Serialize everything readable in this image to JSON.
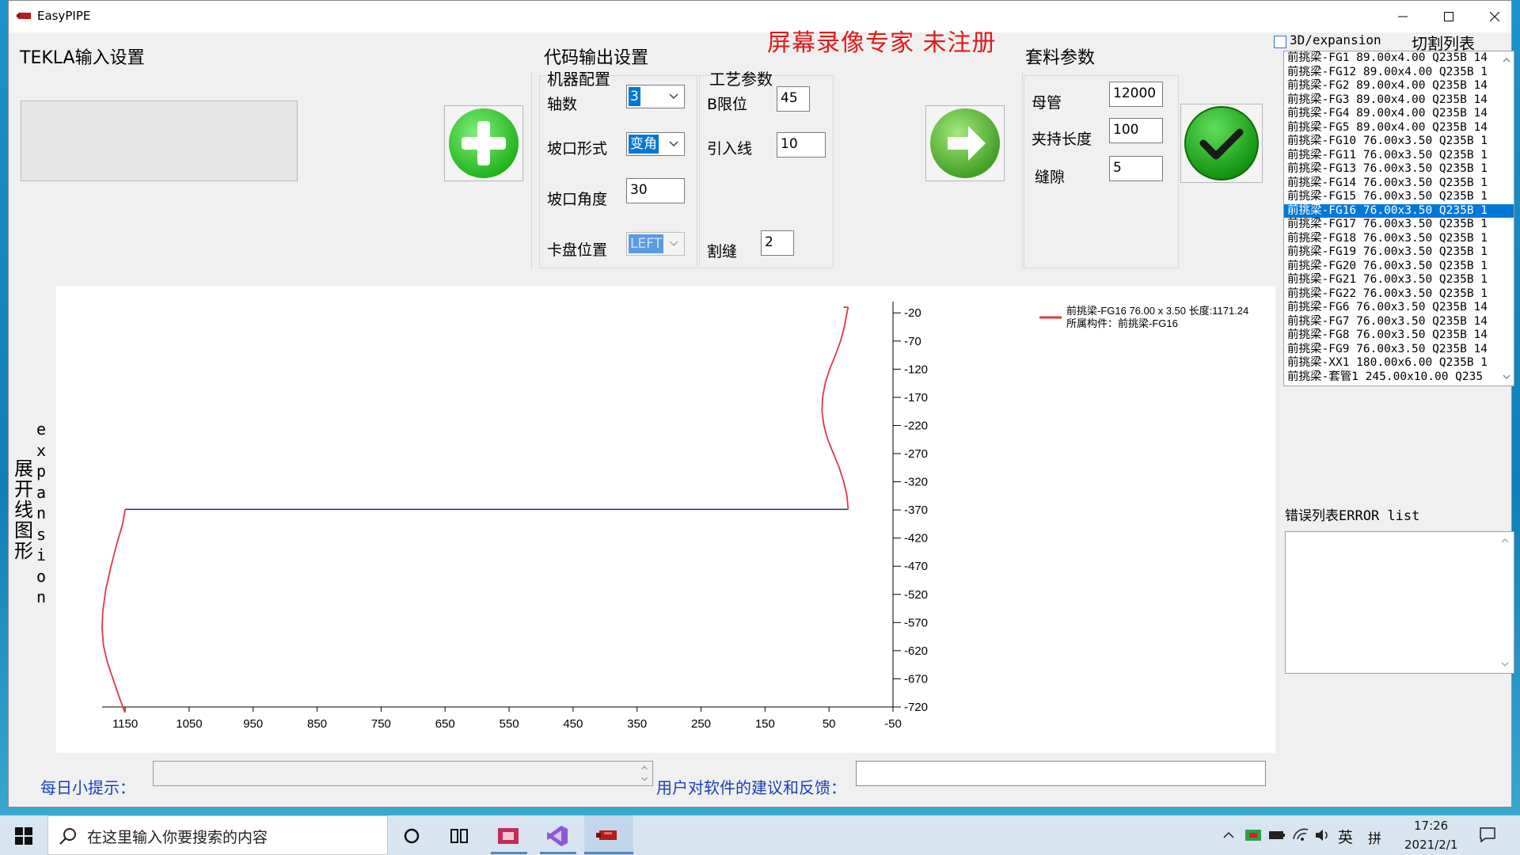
{
  "window": {
    "title": "EasyPIPE"
  },
  "watermark": "屏幕录像专家  未注册",
  "tekla": {
    "title": "TEKLA输入设置"
  },
  "code_output": {
    "title": "代码输出设置",
    "machine": {
      "title": "机器配置",
      "axis_label": "轴数",
      "axis_value": "3",
      "groove_type_label": "坡口形式",
      "groove_type_value": "变角",
      "groove_angle_label": "坡口角度",
      "groove_angle_value": "30",
      "chuck_label": "卡盘位置",
      "chuck_value": "LEFT"
    },
    "process": {
      "title": "工艺参数",
      "b_limit_label": "B限位",
      "b_limit_value": "45",
      "lead_in_label": "引入线",
      "lead_in_value": "10",
      "kerf_label": "割缝",
      "kerf_value": "2"
    }
  },
  "nesting": {
    "title": "套料参数",
    "mother_pipe_label": "母管",
    "mother_pipe_value": "12000",
    "clamp_label": "夹持长度",
    "clamp_value": "100",
    "gap_label": "缝隙",
    "gap_value": "5"
  },
  "right_panel": {
    "checkbox_label": "3D/expansion",
    "cut_list_title": "切割列表",
    "selected_index": 11,
    "items": [
      "前挑梁-FG1 89.00x4.00 Q235B 14",
      "前挑梁-FG12 89.00x4.00 Q235B 1",
      "前挑梁-FG2 89.00x4.00 Q235B 14",
      "前挑梁-FG3 89.00x4.00 Q235B 14",
      "前挑梁-FG4 89.00x4.00 Q235B 14",
      "前挑梁-FG5 89.00x4.00 Q235B 14",
      "前挑梁-FG10 76.00x3.50 Q235B 1",
      "前挑梁-FG11 76.00x3.50 Q235B 1",
      "前挑梁-FG13 76.00x3.50 Q235B 1",
      "前挑梁-FG14 76.00x3.50 Q235B 1",
      "前挑梁-FG15 76.00x3.50 Q235B 1",
      "前挑梁-FG16 76.00x3.50 Q235B 1",
      "前挑梁-FG17 76.00x3.50 Q235B 1",
      "前挑梁-FG18 76.00x3.50 Q235B 1",
      "前挑梁-FG19 76.00x3.50 Q235B 1",
      "前挑梁-FG20 76.00x3.50 Q235B 1",
      "前挑梁-FG21 76.00x3.50 Q235B 1",
      "前挑梁-FG22 76.00x3.50 Q235B 1",
      "前挑梁-FG6 76.00x3.50 Q235B 14",
      "前挑梁-FG7 76.00x3.50 Q235B 14",
      "前挑梁-FG8 76.00x3.50 Q235B 14",
      "前挑梁-FG9 76.00x3.50 Q235B 14",
      "前挑梁-XX1 180.00x6.00 Q235B 1",
      "前挑梁-套管1 245.00x10.00 Q235"
    ],
    "error_title": "错误列表ERROR list"
  },
  "chart_side_label_cn": "展开线图形",
  "chart_side_label_en": "expansion",
  "chart_data": {
    "type": "line",
    "x_ticks": [
      1150,
      1050,
      950,
      850,
      750,
      650,
      550,
      450,
      350,
      250,
      150,
      50,
      -50
    ],
    "y_ticks": [
      -20,
      -70,
      -120,
      -170,
      -220,
      -270,
      -320,
      -370,
      -420,
      -470,
      -520,
      -570,
      -620,
      -670,
      -720
    ],
    "xlim": [
      1186,
      -50
    ],
    "ylim": [
      -720,
      0
    ],
    "legend_line1": "前挑梁-FG16  76.00 x 3.50 长度:1171.24",
    "legend_line2": "所属构件：前挑梁-FG16",
    "colors": {
      "curve": "#e0393e",
      "baseline": "#2a2a7a"
    },
    "baseline_y": -369,
    "series_right": {
      "x": [
        20,
        22,
        27,
        34,
        43,
        52,
        58,
        61,
        60,
        56,
        49,
        40,
        32,
        26,
        22,
        20
      ],
      "y": [
        -369,
        -345,
        -320,
        -295,
        -270,
        -245,
        -220,
        -195,
        -170,
        -145,
        -120,
        -95,
        -70,
        -45,
        -20,
        -10
      ]
    },
    "series_left": {
      "x": [
        1150,
        1154,
        1163,
        1172,
        1180,
        1185,
        1186,
        1184,
        1178,
        1169,
        1160,
        1152,
        1150
      ],
      "y": [
        -369,
        -395,
        -430,
        -470,
        -510,
        -550,
        -580,
        -610,
        -640,
        -670,
        -700,
        -725,
        -730
      ]
    }
  },
  "bottom": {
    "tips_label": "每日小提示：",
    "feedback_label": "用户对软件的建议和反馈："
  },
  "taskbar": {
    "search_placeholder": "在这里输入你要搜索的内容",
    "tray_lang": "英",
    "tray_ime": "拼",
    "time": "17:26",
    "date": "2021/2/1"
  }
}
